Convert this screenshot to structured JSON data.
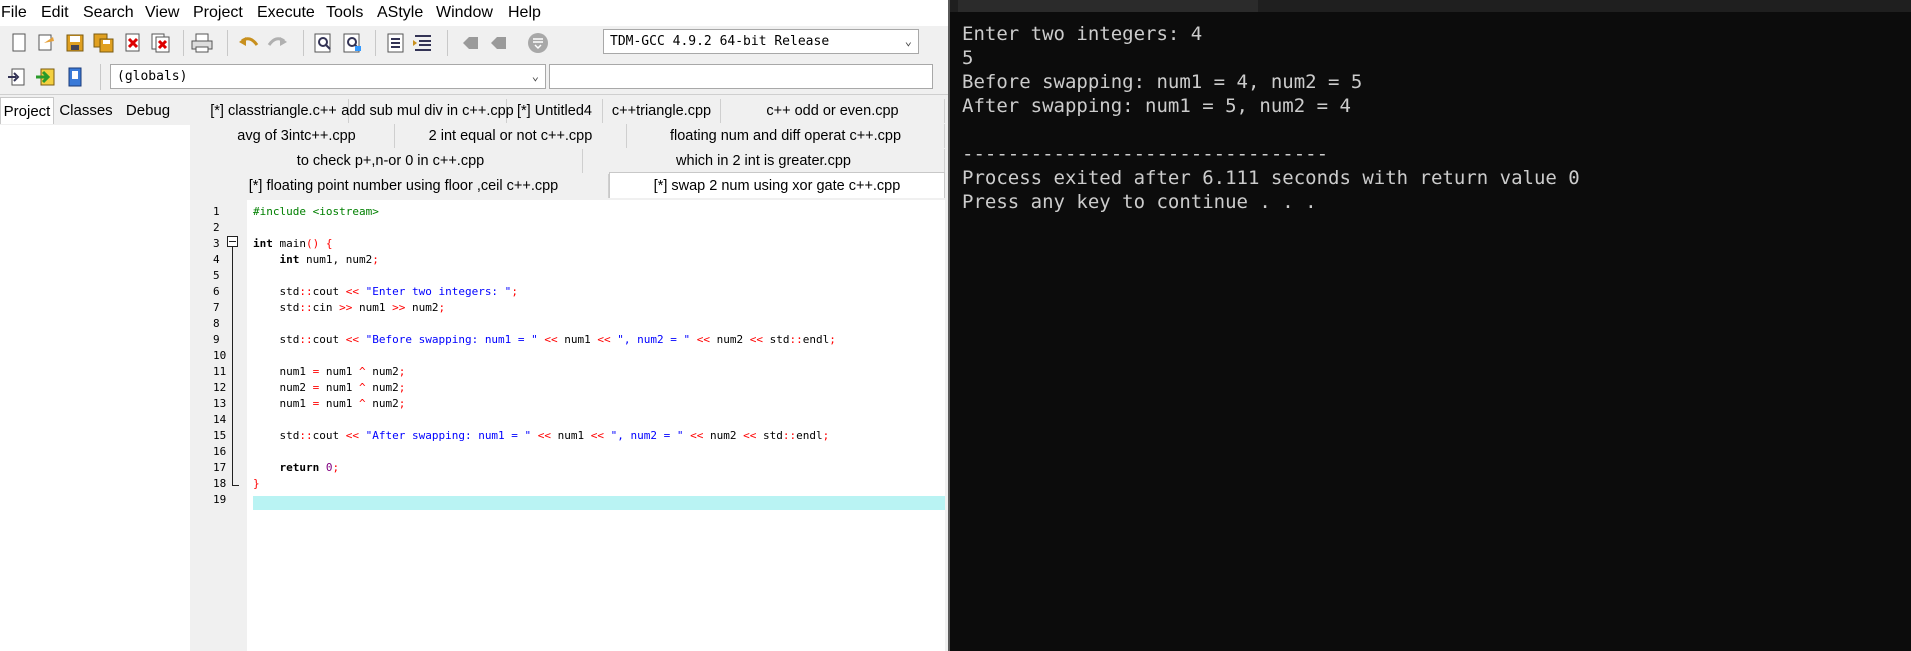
{
  "menu": [
    "File",
    "Edit",
    "Search",
    "View",
    "Project",
    "Execute",
    "Tools",
    "AStyle",
    "Window",
    "Help"
  ],
  "toolbar": {
    "compiler_select": "TDM-GCC 4.9.2 64-bit Release",
    "scope_select": "(globals)",
    "function_select": ""
  },
  "icons": {
    "new_file": "new-file-icon",
    "open": "open-folder-icon",
    "save": "save-icon",
    "save_all": "save-all-icon",
    "close": "close-file-icon",
    "close_all": "close-all-icon",
    "print": "print-icon",
    "undo": "undo-icon",
    "redo": "redo-icon",
    "find": "find-icon",
    "replace": "replace-icon",
    "indent": "indent-icon",
    "unindent": "unindent-icon",
    "bookmark_prev": "bookmark-prev-icon",
    "bookmark_next": "bookmark-next-icon",
    "bookmark_toggle": "bookmark-toggle-icon",
    "goto": "goto-icon",
    "insert": "insert-icon",
    "class_browser": "class-browser-icon"
  },
  "side_tabs": [
    "Project",
    "Classes",
    "Debug"
  ],
  "file_tabs": {
    "row1": [
      "[*] classtriangle.c++",
      "add sub mul div in c++.cpp",
      "[*] Untitled4",
      "c++triangle.cpp",
      "c++ odd or even.cpp"
    ],
    "row2": [
      "avg of 3intc++.cpp",
      "2 int equal or not c++.cpp",
      "floating num and diff operat c++.cpp"
    ],
    "row3": [
      "to check p+,n-or 0 in c++.cpp",
      "which in 2 int is greater.cpp"
    ],
    "row4": [
      "[*] floating point number using floor ,ceil c++.cpp",
      "[*] swap 2 num using xor gate c++.cpp"
    ]
  },
  "line_numbers": [
    "1",
    "2",
    "3",
    "4",
    "5",
    "6",
    "7",
    "8",
    "9",
    "10",
    "11",
    "12",
    "13",
    "14",
    "15",
    "16",
    "17",
    "18",
    "19"
  ],
  "code": {
    "l1": "#include <iostream>",
    "l3a": "int",
    "l3b": " main",
    "l3c": "() {",
    "l4a": "    int",
    "l4b": " num1, num2",
    "l4c": ";",
    "l6a": "    std",
    "l6b": "::",
    "l6c": "cout ",
    "l6d": "<<",
    "l6e": " \"Enter two integers: \"",
    "l6f": ";",
    "l7a": "    std",
    "l7b": "::",
    "l7c": "cin ",
    "l7d": ">>",
    "l7e": " num1 ",
    "l7f": ">>",
    "l7g": " num2",
    "l7h": ";",
    "l9a": "    std",
    "l9b": "::",
    "l9c": "cout ",
    "l9d": "<<",
    "l9e": " \"Before swapping: num1 = \" ",
    "l9f": "<<",
    "l9g": " num1 ",
    "l9h": "<<",
    "l9i": " \", num2 = \" ",
    "l9j": "<<",
    "l9k": " num2 ",
    "l9l": "<<",
    "l9m": " std",
    "l9n": "::",
    "l9o": "endl",
    "l9p": ";",
    "l11a": "    num1 ",
    "l11b": "=",
    "l11c": " num1 ",
    "l11d": "^",
    "l11e": " num2",
    "l11f": ";",
    "l12a": "    num2 ",
    "l12b": "=",
    "l12c": " num1 ",
    "l12d": "^",
    "l12e": " num2",
    "l12f": ";",
    "l13a": "    num1 ",
    "l13b": "=",
    "l13c": " num1 ",
    "l13d": "^",
    "l13e": " num2",
    "l13f": ";",
    "l15a": "    std",
    "l15b": "::",
    "l15c": "cout ",
    "l15d": "<<",
    "l15e": " \"After swapping: num1 = \" ",
    "l15f": "<<",
    "l15g": " num1 ",
    "l15h": "<<",
    "l15i": " \", num2 = \" ",
    "l15j": "<<",
    "l15k": " num2 ",
    "l15l": "<<",
    "l15m": " std",
    "l15n": "::",
    "l15o": "endl",
    "l15p": ";",
    "l17a": "    return",
    "l17b": " ",
    "l17c": "0",
    "l17d": ";",
    "l18": "}"
  },
  "console": {
    "lines": [
      "Enter two integers: 4",
      "5",
      "Before swapping: num1 = 4, num2 = 5",
      "After swapping: num1 = 5, num2 = 4",
      "",
      "--------------------------------",
      "Process exited after 6.111 seconds with return value 0",
      "Press any key to continue . . ."
    ]
  },
  "colors": {
    "console_bg": "#0c0c0c",
    "console_fg": "#cccccc",
    "current_line": "#b9f3f3",
    "string": "#0000ff",
    "operator": "#ff0000",
    "preprocessor": "#008000",
    "number": "#800080"
  }
}
